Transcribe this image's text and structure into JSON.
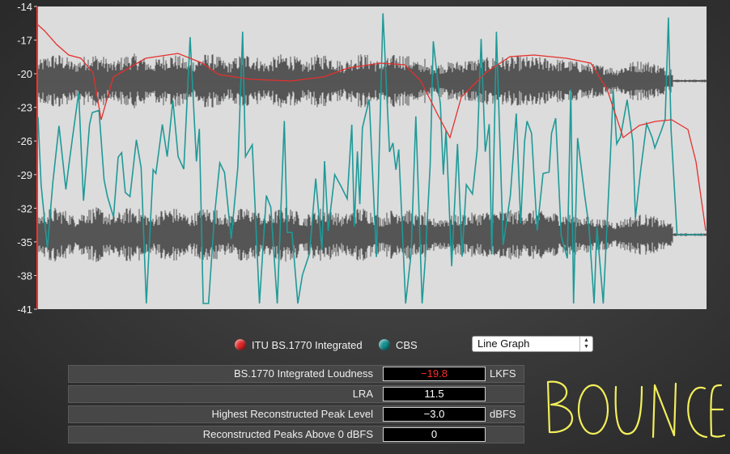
{
  "graph": {
    "y_ticks": [
      "-14",
      "-17",
      "-20",
      "-23",
      "-26",
      "-29",
      "-32",
      "-35",
      "-38",
      "-41"
    ],
    "colors": {
      "background": "#dcdcdc",
      "waveform": "#555555",
      "itu_line": "#e4302e",
      "cbs_line": "#1f9a98"
    }
  },
  "legend": {
    "itu_label": "ITU BS.1770 Integrated",
    "cbs_label": "CBS"
  },
  "view_select": {
    "selected": "Line Graph"
  },
  "metrics": [
    {
      "label": "BS.1770 Integrated Loudness",
      "value": "−19.8",
      "unit": "LKFS"
    },
    {
      "label": "LRA",
      "value": "11.5",
      "unit": ""
    },
    {
      "label": "Highest Reconstructed Peak Level",
      "value": "−3.0",
      "unit": "dBFS"
    },
    {
      "label": "Reconstructed Peaks Above 0 dBFS",
      "value": "0",
      "unit": ""
    }
  ],
  "annotation": {
    "text": "BOUNCE",
    "color": "#f2ee5a"
  }
}
